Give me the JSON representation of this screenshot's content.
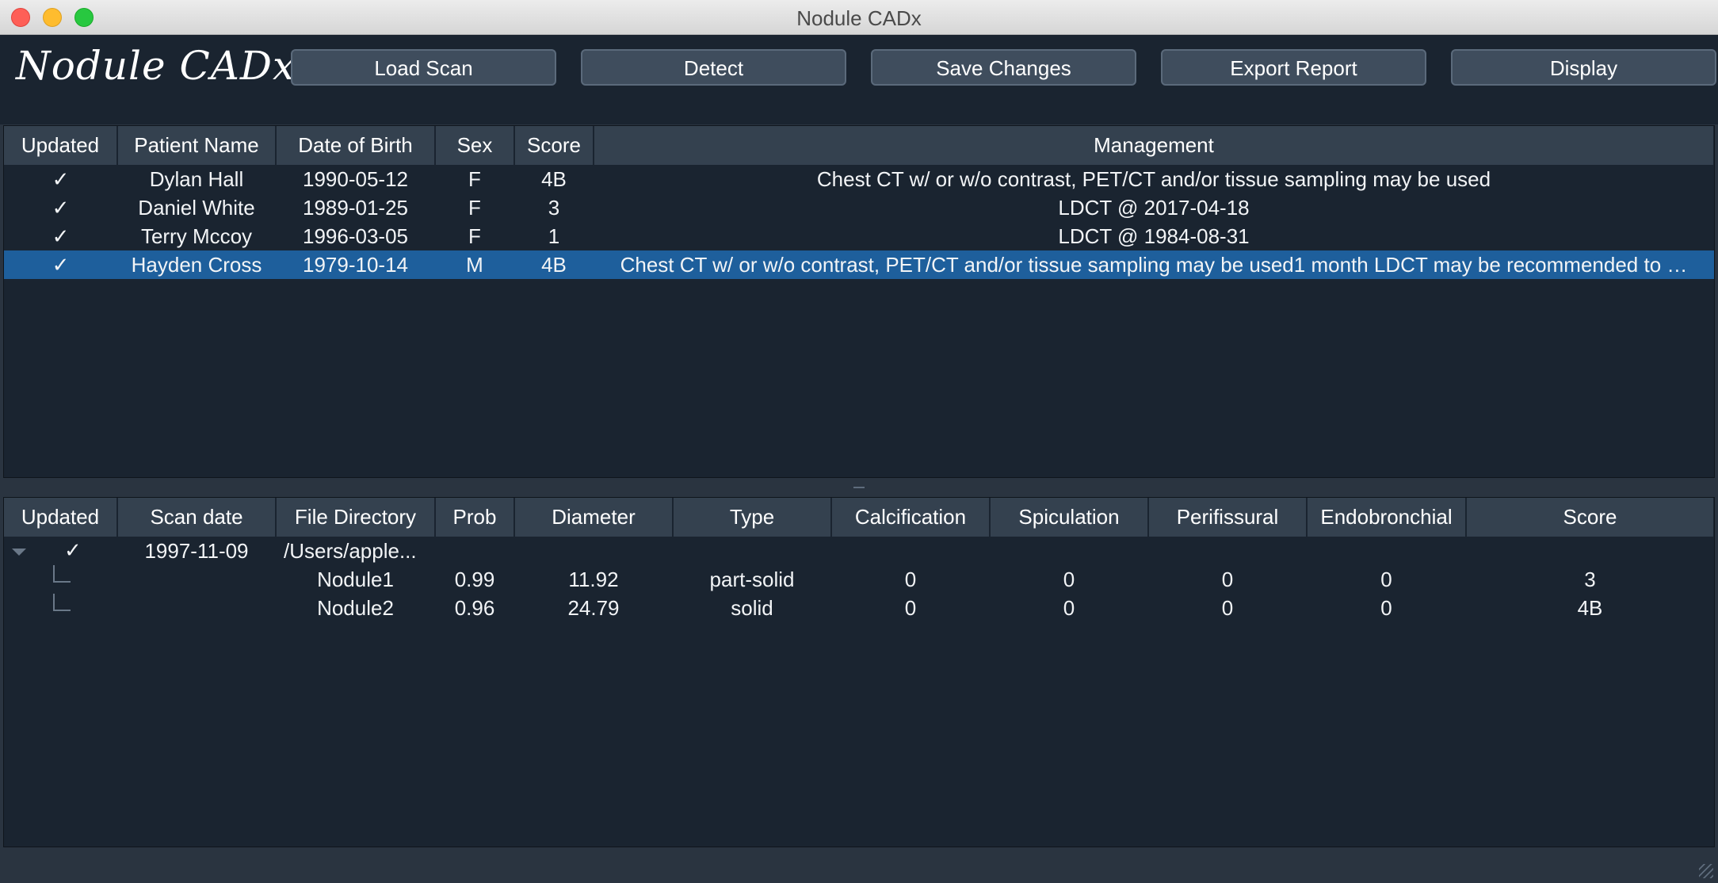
{
  "window": {
    "title": "Nodule CADx"
  },
  "app": {
    "brand": "Nodule CADx"
  },
  "toolbar": {
    "load_scan": "Load Scan",
    "detect": "Detect",
    "save_changes": "Save Changes",
    "export_report": "Export Report",
    "display": "Display"
  },
  "patients": {
    "headers": [
      "Updated",
      "Patient Name",
      "Date of Birth",
      "Sex",
      "Score",
      "Management"
    ],
    "rows": [
      {
        "updated": "✓",
        "name": "Dylan Hall",
        "dob": "1990-05-12",
        "sex": "F",
        "score": "4B",
        "management": "Chest CT w/ or w/o contrast, PET/CT and/or tissue sampling may be used"
      },
      {
        "updated": "✓",
        "name": "Daniel White",
        "dob": "1989-01-25",
        "sex": "F",
        "score": "3",
        "management": "LDCT @ 2017-04-18"
      },
      {
        "updated": "✓",
        "name": "Terry Mccoy",
        "dob": "1996-03-05",
        "sex": "F",
        "score": "1",
        "management": "LDCT @ 1984-08-31"
      },
      {
        "updated": "✓",
        "name": "Hayden Cross",
        "dob": "1979-10-14",
        "sex": "M",
        "score": "4B",
        "management": "Chest CT w/ or w/o contrast, PET/CT and/or tissue sampling may be used1 month LDCT may be recommended to …"
      }
    ],
    "selected_index": 3
  },
  "scans": {
    "headers": [
      "Updated",
      "Scan date",
      "File Directory",
      "Prob",
      "Diameter",
      "Type",
      "Calcification",
      "Spiculation",
      "Perifissural",
      "Endobronchial",
      "Score"
    ],
    "scan": {
      "updated": "✓",
      "date": "1997-11-09",
      "directory": "/Users/apple..."
    },
    "nodules": [
      {
        "name": "Nodule1",
        "prob": "0.99",
        "diameter": "11.92",
        "type": "part-solid",
        "calcification": "0",
        "spiculation": "0",
        "perifissural": "0",
        "endobronchial": "0",
        "score": "3"
      },
      {
        "name": "Nodule2",
        "prob": "0.96",
        "diameter": "24.79",
        "type": "solid",
        "calcification": "0",
        "spiculation": "0",
        "perifissural": "0",
        "endobronchial": "0",
        "score": "4B"
      }
    ]
  },
  "colors": {
    "background": "#1a2430",
    "header_cell": "#34414f",
    "selection": "#1e5f9c",
    "button": "#3f4d5d"
  }
}
